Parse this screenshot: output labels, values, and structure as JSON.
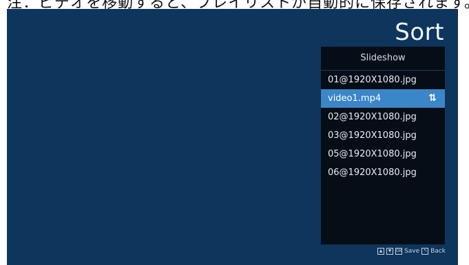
{
  "header_text": "注：ビデオを移動すると、プレイリストが自動的に保存されます。",
  "page": {
    "title": "Sort"
  },
  "panel": {
    "title": "Slideshow"
  },
  "items": [
    {
      "label": "01@1920X1080.jpg"
    },
    {
      "label": "video1.mp4",
      "selected": true
    },
    {
      "label": "02@1920X1080.jpg"
    },
    {
      "label": "03@1920X1080.jpg"
    },
    {
      "label": "05@1920X1080.jpg"
    },
    {
      "label": "06@1920X1080.jpg"
    }
  ],
  "footer": {
    "icons": [
      "up-arrow-key-icon",
      "down-arrow-key-icon",
      "ok-key-icon",
      "back-key-icon"
    ],
    "save_label": "Save",
    "back_label": "Back"
  },
  "colors": {
    "background": "#0e355b",
    "panel": "#050d17",
    "selected": "#3b86c8"
  }
}
